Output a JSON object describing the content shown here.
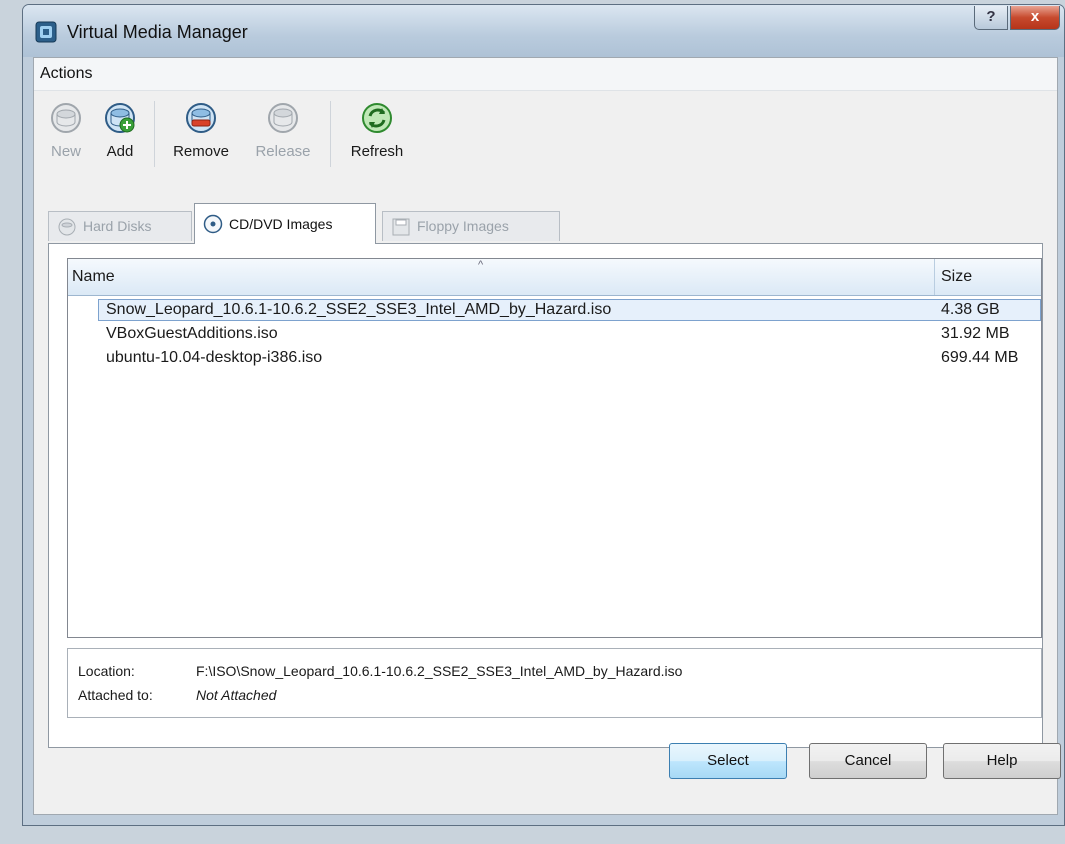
{
  "window": {
    "title": "Virtual Media Manager",
    "help_glyph": "?",
    "close_glyph": "x"
  },
  "menubar": {
    "items": [
      "Actions"
    ]
  },
  "toolbar": {
    "new_label": "New",
    "add_label": "Add",
    "remove_label": "Remove",
    "release_label": "Release",
    "refresh_label": "Refresh"
  },
  "tabs": [
    {
      "label": "Hard Disks",
      "active": false
    },
    {
      "label": "CD/DVD Images",
      "active": true
    },
    {
      "label": "Floppy Images",
      "active": false
    }
  ],
  "list": {
    "columns": {
      "name": "Name",
      "size": "Size"
    },
    "rows": [
      {
        "name": "Snow_Leopard_10.6.1-10.6.2_SSE2_SSE3_Intel_AMD_by_Hazard.iso",
        "size": "4.38 GB",
        "selected": true
      },
      {
        "name": "VBoxGuestAdditions.iso",
        "size": "31.92 MB",
        "selected": false
      },
      {
        "name": "ubuntu-10.04-desktop-i386.iso",
        "size": "699.44 MB",
        "selected": false
      }
    ]
  },
  "info": {
    "location_label": "Location:",
    "location_value": "F:\\ISO\\Snow_Leopard_10.6.1-10.6.2_SSE2_SSE3_Intel_AMD_by_Hazard.iso",
    "attached_label": "Attached to:",
    "attached_value": "Not Attached"
  },
  "buttons": {
    "select": "Select",
    "cancel": "Cancel",
    "help": "Help"
  },
  "icons": {
    "title": "virtualbox-icon",
    "new": "new-disk-icon",
    "add": "add-disk-icon",
    "remove": "remove-disk-icon",
    "release": "release-disk-icon",
    "refresh": "refresh-icon"
  }
}
